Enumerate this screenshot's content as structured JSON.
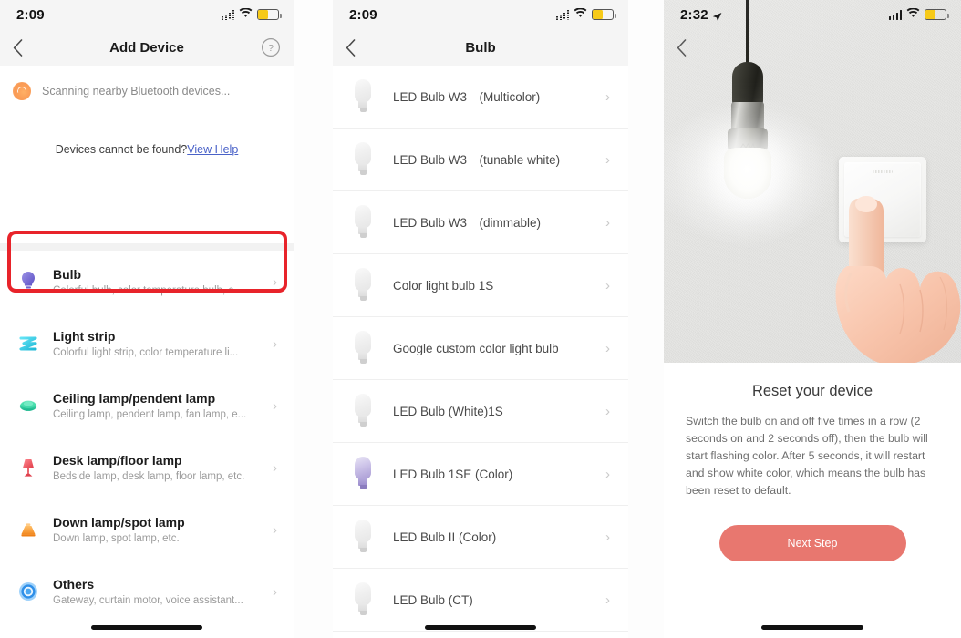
{
  "panels": [
    {
      "status": {
        "time": "2:09",
        "signal": "cellular-dotted-icon",
        "wifi": "wifi-icon",
        "battery": "battery-icon",
        "battery_level": 52
      },
      "nav": {
        "back": "back-chevron-icon",
        "title": "Add Device",
        "help": "help-circle-icon"
      },
      "scan": {
        "icon": "bluetooth-scan-icon",
        "text": "Scanning nearby Bluetooth devices...",
        "not_found_text": "Devices cannot be found?",
        "help_link": "View Help"
      },
      "categories": [
        {
          "icon": "bulb-icon",
          "title": "Bulb",
          "subtitle": "Colorful bulb, color temperature bulb, c...",
          "chevron": "chevron-right-icon",
          "highlighted": true
        },
        {
          "icon": "light-strip-icon",
          "title": "Light strip",
          "subtitle": "Colorful light strip, color temperature li...",
          "chevron": "chevron-right-icon",
          "highlighted": false
        },
        {
          "icon": "ceiling-lamp-icon",
          "title": "Ceiling lamp/pendent lamp",
          "subtitle": "Ceiling lamp, pendent lamp, fan lamp, e...",
          "chevron": "chevron-right-icon",
          "highlighted": false
        },
        {
          "icon": "desk-lamp-icon",
          "title": "Desk lamp/floor lamp",
          "subtitle": "Bedside lamp, desk lamp, floor lamp, etc.",
          "chevron": "chevron-right-icon",
          "highlighted": false
        },
        {
          "icon": "down-lamp-icon",
          "title": "Down lamp/spot lamp",
          "subtitle": "Down lamp, spot lamp, etc.",
          "chevron": "chevron-right-icon",
          "highlighted": false
        },
        {
          "icon": "others-icon",
          "title": "Others",
          "subtitle": "Gateway, curtain motor, voice assistant...",
          "chevron": "chevron-right-icon",
          "highlighted": false
        }
      ]
    },
    {
      "status": {
        "time": "2:09",
        "signal": "cellular-dotted-icon",
        "wifi": "wifi-icon",
        "battery": "battery-icon",
        "battery_level": 52
      },
      "nav": {
        "back": "back-chevron-icon",
        "title": "Bulb"
      },
      "bulbs": [
        {
          "icon": "bulb-white-icon",
          "name": "LED Bulb W3 (Multicolor)",
          "chevron": "chevron-right-icon",
          "highlighted": true,
          "color": false
        },
        {
          "icon": "bulb-white-icon",
          "name": "LED Bulb W3 (tunable white)",
          "chevron": "chevron-right-icon",
          "highlighted": false,
          "color": false
        },
        {
          "icon": "bulb-white-icon",
          "name": "LED Bulb W3 (dimmable)",
          "chevron": "chevron-right-icon",
          "highlighted": false,
          "color": false
        },
        {
          "icon": "bulb-white-icon",
          "name": "Color light bulb 1S",
          "chevron": "chevron-right-icon",
          "highlighted": false,
          "color": false
        },
        {
          "icon": "bulb-white-icon",
          "name": "Google custom color light bulb",
          "chevron": "chevron-right-icon",
          "highlighted": false,
          "color": false
        },
        {
          "icon": "bulb-white-icon",
          "name": "LED Bulb (White)1S",
          "chevron": "chevron-right-icon",
          "highlighted": false,
          "color": false
        },
        {
          "icon": "bulb-purple-icon",
          "name": "LED Bulb 1SE (Color)",
          "chevron": "chevron-right-icon",
          "highlighted": false,
          "color": true
        },
        {
          "icon": "bulb-white-icon",
          "name": "LED Bulb II (Color)",
          "chevron": "chevron-right-icon",
          "highlighted": false,
          "color": false
        },
        {
          "icon": "bulb-white-icon",
          "name": "LED Bulb (CT)",
          "chevron": "chevron-right-icon",
          "highlighted": false,
          "color": false
        }
      ]
    },
    {
      "status": {
        "time": "2:32",
        "location": "location-arrow-icon",
        "signal": "cellular-full-icon",
        "wifi": "wifi-icon",
        "battery": "battery-icon",
        "battery_level": 52
      },
      "nav": {
        "back": "back-chevron-icon",
        "title": ""
      },
      "hero": {
        "alt": "pendant-bulb-and-wall-switch-illustration"
      },
      "reset": {
        "title": "Reset your device",
        "body": "Switch the bulb on and off five times in a row (2 seconds on and 2 seconds off), then the bulb will start flashing color. After 5 seconds, it will restart and show white color, which means the bulb has been reset to default.",
        "next_label": "Next Step"
      }
    }
  ],
  "colors": {
    "highlight_red": "#e8232a",
    "primary_button": "#e8776f",
    "link": "#4a62c8",
    "battery_fill": "#f7ca18",
    "bulb_icon": "#7b6fd4",
    "strip_icon": "#3fd0e8",
    "ceiling_icon": "#3fd6a8",
    "desk_icon": "#ef5a62",
    "down_icon": "#f79a3c",
    "others_icon": "#3f9bef"
  }
}
